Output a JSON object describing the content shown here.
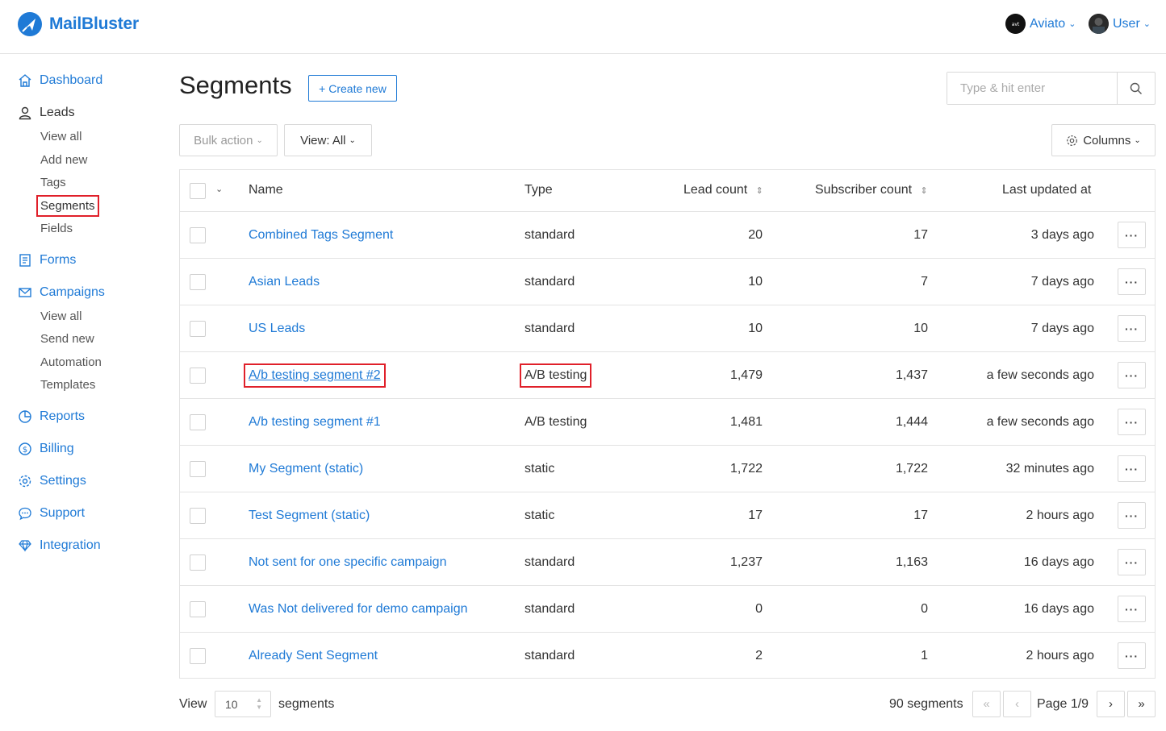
{
  "brand": {
    "name": "MailBluster",
    "color": "#1f7ad6"
  },
  "header": {
    "org_name": "Aviato",
    "user_name": "User"
  },
  "sidebar": {
    "dashboard": "Dashboard",
    "leads": "Leads",
    "leads_items": [
      "View all",
      "Add new",
      "Tags",
      "Segments",
      "Fields"
    ],
    "forms": "Forms",
    "campaigns": "Campaigns",
    "campaigns_items": [
      "View all",
      "Send new",
      "Automation",
      "Templates"
    ],
    "reports": "Reports",
    "billing": "Billing",
    "settings": "Settings",
    "support": "Support",
    "integration": "Integration",
    "active_item": "Segments"
  },
  "main": {
    "title": "Segments",
    "create_label": "+ Create new",
    "search_placeholder": "Type & hit enter",
    "bulk_action": "Bulk action",
    "view_filter": "View: All",
    "columns_label": "Columns"
  },
  "table": {
    "headers": {
      "name": "Name",
      "type": "Type",
      "lead_count": "Lead count",
      "subscriber_count": "Subscriber count",
      "last_updated": "Last updated at"
    },
    "rows": [
      {
        "name": "Combined Tags Segment",
        "type": "standard",
        "lead_count": "20",
        "subscriber_count": "17",
        "updated": "3 days ago"
      },
      {
        "name": "Asian Leads",
        "type": "standard",
        "lead_count": "10",
        "subscriber_count": "7",
        "updated": "7 days ago"
      },
      {
        "name": "US Leads",
        "type": "standard",
        "lead_count": "10",
        "subscriber_count": "10",
        "updated": "7 days ago"
      },
      {
        "name": "A/b testing segment #2",
        "type": "A/B testing",
        "lead_count": "1,479",
        "subscriber_count": "1,437",
        "updated": "a few seconds ago"
      },
      {
        "name": "A/b testing segment #1",
        "type": "A/B testing",
        "lead_count": "1,481",
        "subscriber_count": "1,444",
        "updated": "a few seconds ago"
      },
      {
        "name": "My Segment (static)",
        "type": "static",
        "lead_count": "1,722",
        "subscriber_count": "1,722",
        "updated": "32 minutes ago"
      },
      {
        "name": "Test Segment (static)",
        "type": "static",
        "lead_count": "17",
        "subscriber_count": "17",
        "updated": "2 hours ago"
      },
      {
        "name": "Not sent for one specific campaign",
        "type": "standard",
        "lead_count": "1,237",
        "subscriber_count": "1,163",
        "updated": "16 days ago"
      },
      {
        "name": "Was Not delivered for demo campaign",
        "type": "standard",
        "lead_count": "0",
        "subscriber_count": "0",
        "updated": "16 days ago"
      },
      {
        "name": "Already Sent Segment",
        "type": "standard",
        "lead_count": "2",
        "subscriber_count": "1",
        "updated": "2 hours ago"
      }
    ],
    "more_label": "···"
  },
  "footer": {
    "view_label": "View",
    "per_page": "10",
    "unit_label": "segments",
    "total": "90 segments",
    "page": "Page 1/9"
  }
}
